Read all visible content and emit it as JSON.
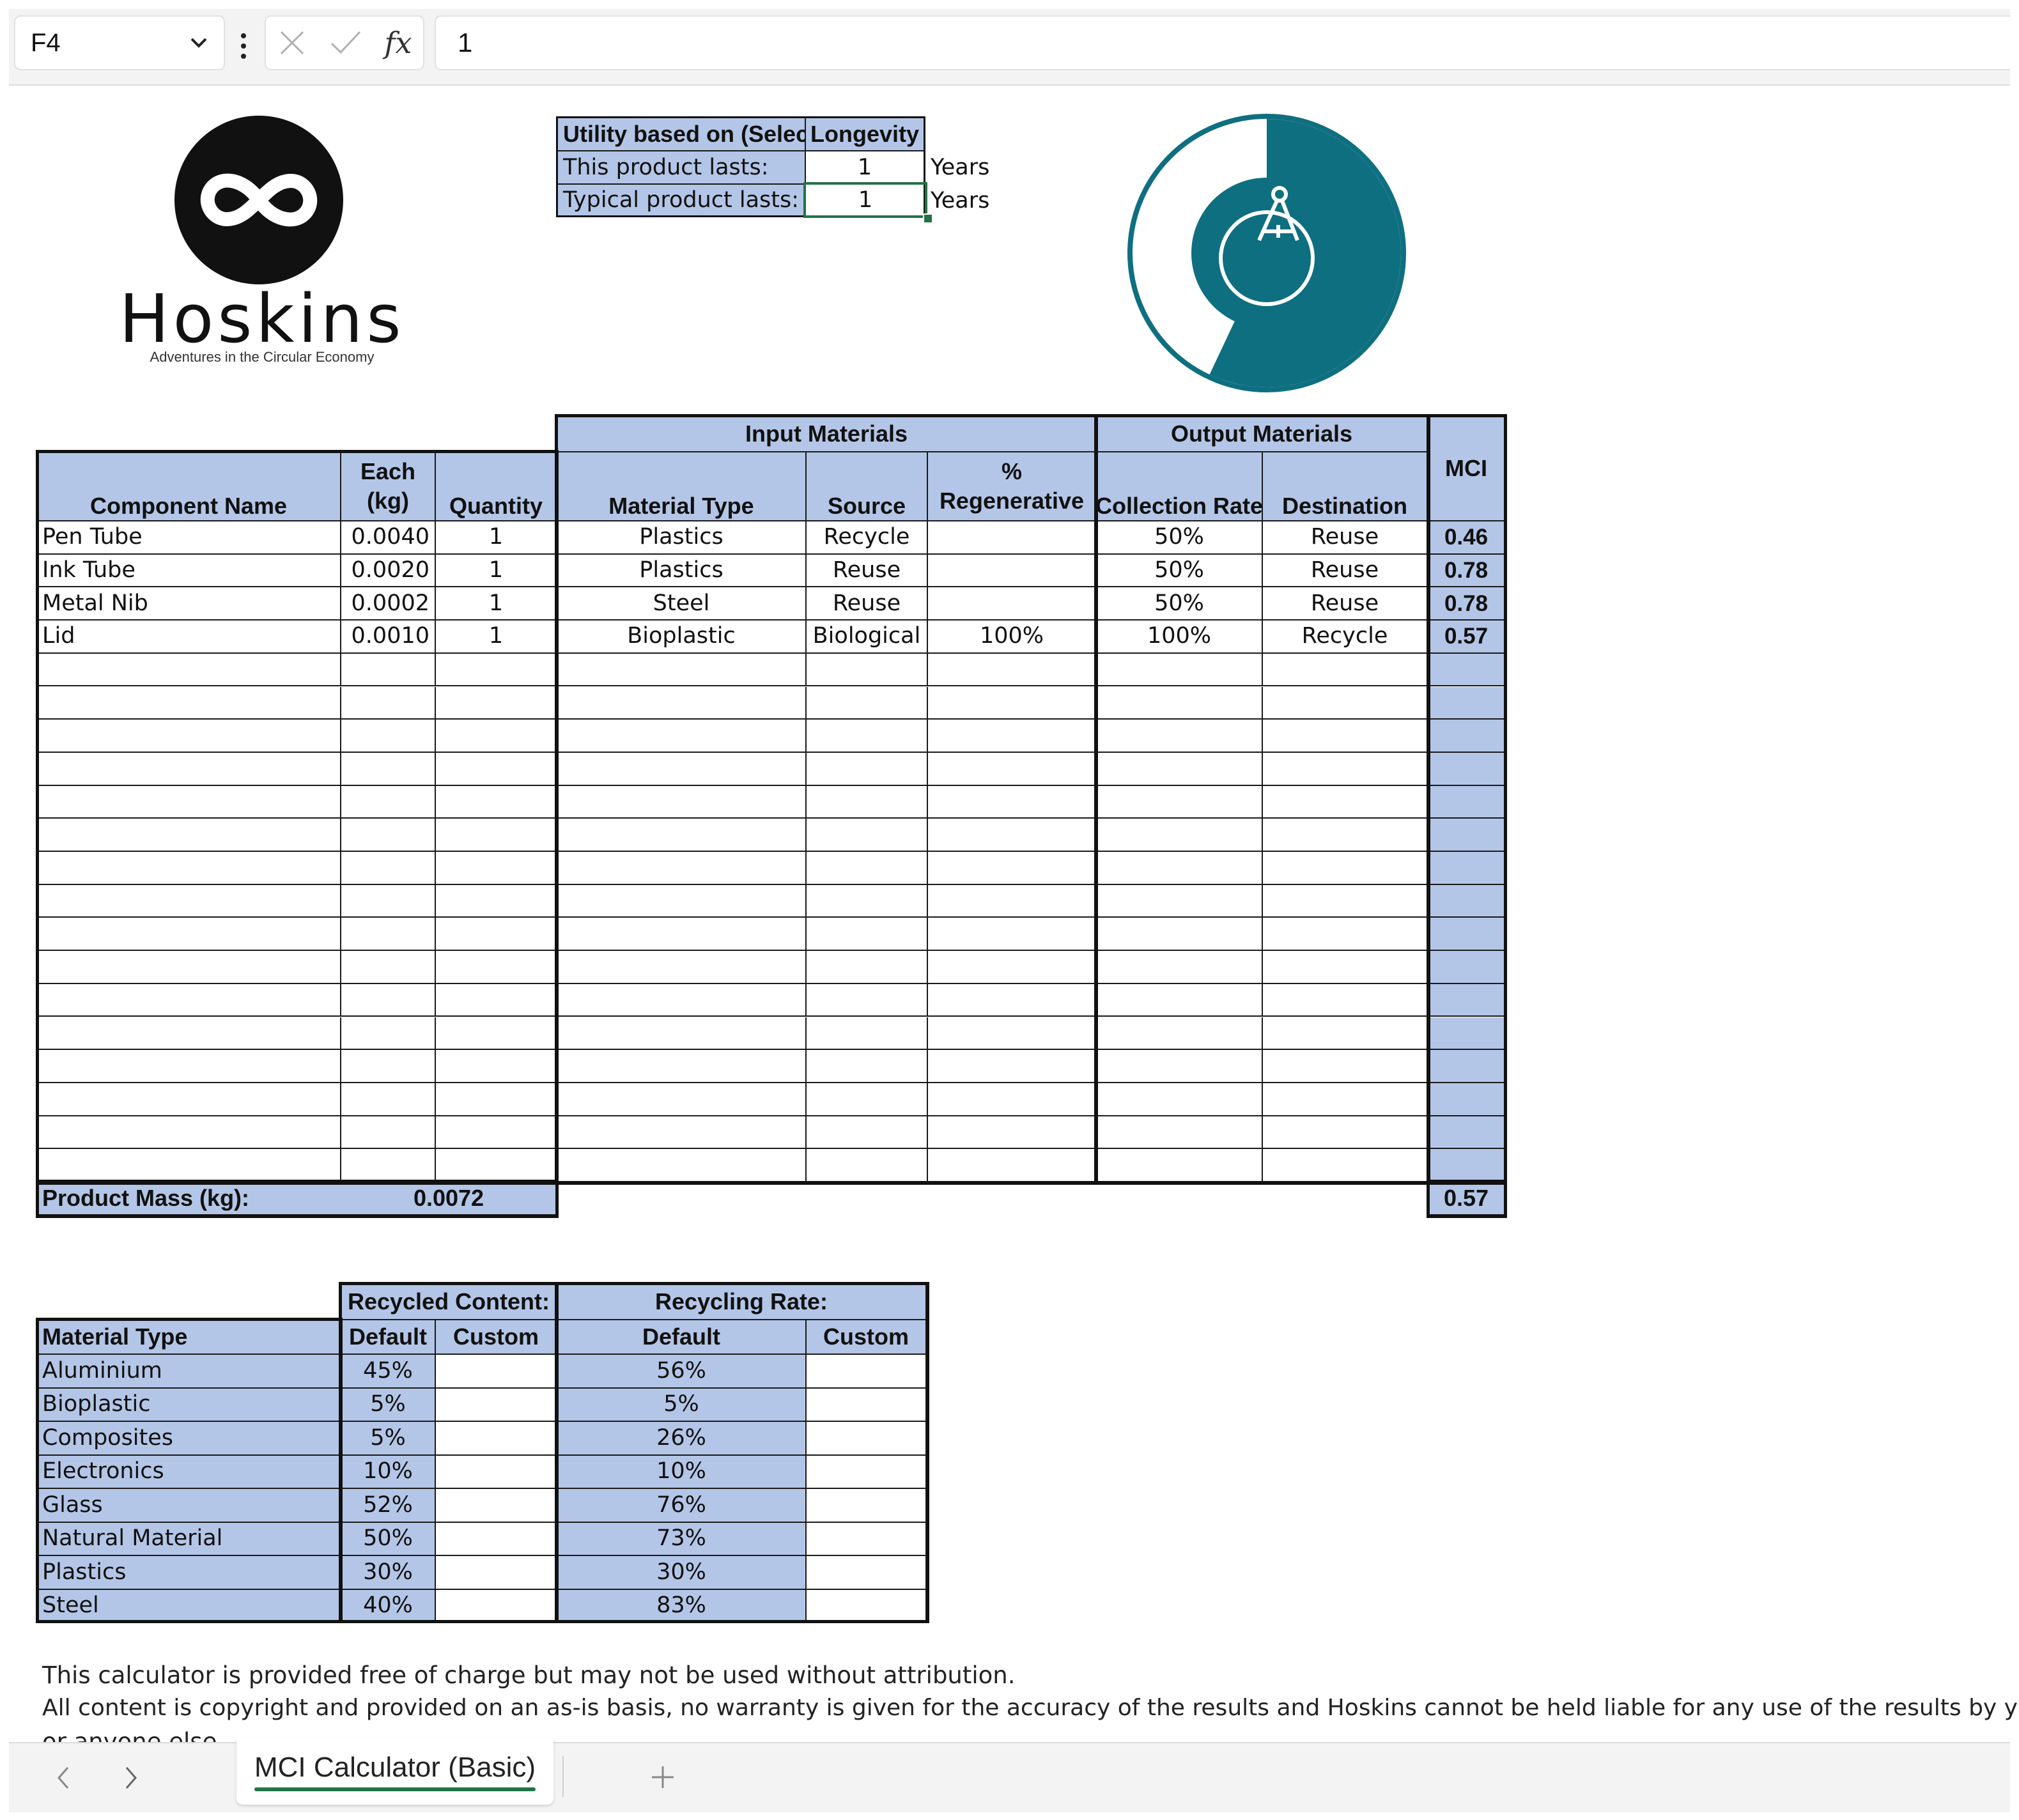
{
  "formula_bar": {
    "name_box": "F4",
    "formula_value": "1",
    "fx_label": "fx"
  },
  "logo": {
    "name": "Hoskins",
    "tagline": "Adventures in the Circular Economy"
  },
  "utility": {
    "header_label": "Utility based on (Select)",
    "header_value": "Longevity",
    "rows": [
      {
        "label": "This product lasts:",
        "value": "1",
        "unit": "Years"
      },
      {
        "label": "Typical product lasts:",
        "value": "1",
        "unit": "Years"
      }
    ]
  },
  "gauge": {
    "fraction": 0.57,
    "color": "#0e6f80"
  },
  "main_table": {
    "group_input": "Input Materials",
    "group_output": "Output Materials",
    "headers": {
      "component": "Component Name",
      "each_top": "Each",
      "each_bottom": "(kg)",
      "quantity": "Quantity",
      "material": "Material Type",
      "source": "Source",
      "regen_top": "%",
      "regen_bottom": "Regenerative",
      "collection": "Collection Rate",
      "destination": "Destination",
      "mci": "MCI"
    },
    "rows": [
      {
        "name": "Pen Tube",
        "each": "0.0040",
        "qty": "1",
        "material": "Plastics",
        "source": "Recycle",
        "regen": "",
        "collection": "50%",
        "destination": "Reuse",
        "mci": "0.46"
      },
      {
        "name": "Ink Tube",
        "each": "0.0020",
        "qty": "1",
        "material": "Plastics",
        "source": "Reuse",
        "regen": "",
        "collection": "50%",
        "destination": "Reuse",
        "mci": "0.78"
      },
      {
        "name": "Metal Nib",
        "each": "0.0002",
        "qty": "1",
        "material": "Steel",
        "source": "Reuse",
        "regen": "",
        "collection": "50%",
        "destination": "Reuse",
        "mci": "0.78"
      },
      {
        "name": "Lid",
        "each": "0.0010",
        "qty": "1",
        "material": "Bioplastic",
        "source": "Biological",
        "regen": "100%",
        "collection": "100%",
        "destination": "Recycle",
        "mci": "0.57"
      },
      {
        "name": "",
        "each": "",
        "qty": "",
        "material": "",
        "source": "",
        "regen": "",
        "collection": "",
        "destination": "",
        "mci": ""
      },
      {
        "name": "",
        "each": "",
        "qty": "",
        "material": "",
        "source": "",
        "regen": "",
        "collection": "",
        "destination": "",
        "mci": ""
      },
      {
        "name": "",
        "each": "",
        "qty": "",
        "material": "",
        "source": "",
        "regen": "",
        "collection": "",
        "destination": "",
        "mci": ""
      },
      {
        "name": "",
        "each": "",
        "qty": "",
        "material": "",
        "source": "",
        "regen": "",
        "collection": "",
        "destination": "",
        "mci": ""
      },
      {
        "name": "",
        "each": "",
        "qty": "",
        "material": "",
        "source": "",
        "regen": "",
        "collection": "",
        "destination": "",
        "mci": ""
      },
      {
        "name": "",
        "each": "",
        "qty": "",
        "material": "",
        "source": "",
        "regen": "",
        "collection": "",
        "destination": "",
        "mci": ""
      },
      {
        "name": "",
        "each": "",
        "qty": "",
        "material": "",
        "source": "",
        "regen": "",
        "collection": "",
        "destination": "",
        "mci": ""
      },
      {
        "name": "",
        "each": "",
        "qty": "",
        "material": "",
        "source": "",
        "regen": "",
        "collection": "",
        "destination": "",
        "mci": ""
      },
      {
        "name": "",
        "each": "",
        "qty": "",
        "material": "",
        "source": "",
        "regen": "",
        "collection": "",
        "destination": "",
        "mci": ""
      },
      {
        "name": "",
        "each": "",
        "qty": "",
        "material": "",
        "source": "",
        "regen": "",
        "collection": "",
        "destination": "",
        "mci": ""
      },
      {
        "name": "",
        "each": "",
        "qty": "",
        "material": "",
        "source": "",
        "regen": "",
        "collection": "",
        "destination": "",
        "mci": ""
      },
      {
        "name": "",
        "each": "",
        "qty": "",
        "material": "",
        "source": "",
        "regen": "",
        "collection": "",
        "destination": "",
        "mci": ""
      },
      {
        "name": "",
        "each": "",
        "qty": "",
        "material": "",
        "source": "",
        "regen": "",
        "collection": "",
        "destination": "",
        "mci": ""
      },
      {
        "name": "",
        "each": "",
        "qty": "",
        "material": "",
        "source": "",
        "regen": "",
        "collection": "",
        "destination": "",
        "mci": ""
      },
      {
        "name": "",
        "each": "",
        "qty": "",
        "material": "",
        "source": "",
        "regen": "",
        "collection": "",
        "destination": "",
        "mci": ""
      },
      {
        "name": "",
        "each": "",
        "qty": "",
        "material": "",
        "source": "",
        "regen": "",
        "collection": "",
        "destination": "",
        "mci": ""
      }
    ],
    "footer_label": "Product Mass (kg):",
    "footer_mass": "0.0072",
    "footer_mci": "0.57"
  },
  "rates_table": {
    "group_recycled": "Recycled Content:",
    "group_recycling": "Recycling Rate:",
    "headers": {
      "material": "Material Type",
      "rc_default": "Default",
      "rc_custom": "Custom",
      "rr_default": "Default",
      "rr_custom": "Custom"
    },
    "rows": [
      {
        "material": "Aluminium",
        "rc_default": "45%",
        "rc_custom": "",
        "rr_default": "56%",
        "rr_custom": ""
      },
      {
        "material": "Bioplastic",
        "rc_default": "5%",
        "rc_custom": "",
        "rr_default": "5%",
        "rr_custom": ""
      },
      {
        "material": "Composites",
        "rc_default": "5%",
        "rc_custom": "",
        "rr_default": "26%",
        "rr_custom": ""
      },
      {
        "material": "Electronics",
        "rc_default": "10%",
        "rc_custom": "",
        "rr_default": "10%",
        "rr_custom": ""
      },
      {
        "material": "Glass",
        "rc_default": "52%",
        "rc_custom": "",
        "rr_default": "76%",
        "rr_custom": ""
      },
      {
        "material": "Natural Material",
        "rc_default": "50%",
        "rc_custom": "",
        "rr_default": "73%",
        "rr_custom": ""
      },
      {
        "material": "Plastics",
        "rc_default": "30%",
        "rc_custom": "",
        "rr_default": "30%",
        "rr_custom": ""
      },
      {
        "material": "Steel",
        "rc_default": "40%",
        "rc_custom": "",
        "rr_default": "83%",
        "rr_custom": ""
      }
    ]
  },
  "notes": {
    "line1": "This calculator is provided free of charge but may not be used without attribution.",
    "line2": "All content is copyright and provided on an as-is basis, no warranty is given for the accuracy of the results and Hoskins cannot be held liable for any use of the results by you",
    "line3": "or anyone else."
  },
  "sheet_tabs": {
    "active": "MCI Calculator (Basic)"
  },
  "colors": {
    "header_fill": "#b4c6e7",
    "gauge_teal": "#0e6f80",
    "active_cell_border": "#217346"
  }
}
